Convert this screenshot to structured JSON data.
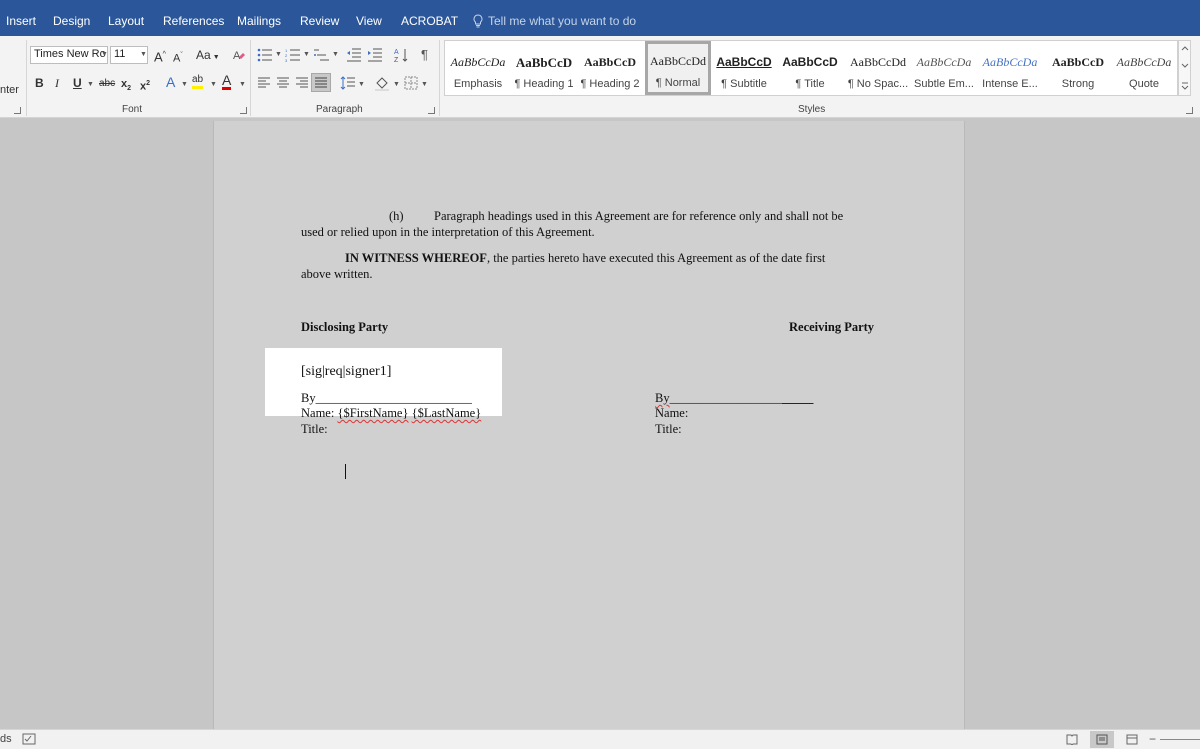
{
  "tabs": [
    "Insert",
    "Design",
    "Layout",
    "References",
    "Mailings",
    "Review",
    "View",
    "ACROBAT"
  ],
  "tell_me": "Tell me what you want to do",
  "ribbon": {
    "clipboard_fragment": "nter",
    "font": {
      "name": "Times New Ro",
      "size": "11",
      "grow": "A",
      "shrink": "A",
      "change_case": "Aa",
      "bold": "B",
      "italic": "I",
      "underline": "U",
      "strikethrough": "abc",
      "subscript": "x",
      "superscript": "x",
      "text_effects": "A",
      "highlight": "ab",
      "font_color": "A",
      "group_label": "Font"
    },
    "paragraph": {
      "group_label": "Paragraph",
      "pilcrow": "¶"
    },
    "styles": {
      "group_label": "Styles",
      "items": [
        {
          "preview": "AaBbCcDa",
          "name": "Emphasis"
        },
        {
          "preview": "AaBbCcD",
          "name": "¶ Heading 1"
        },
        {
          "preview": "AaBbCcD",
          "name": "¶ Heading 2"
        },
        {
          "preview": "AaBbCcDd",
          "name": "¶ Normal"
        },
        {
          "preview": "AaBbCcD",
          "name": "¶ Subtitle"
        },
        {
          "preview": "AaBbCcD",
          "name": "¶ Title"
        },
        {
          "preview": "AaBbCcDd",
          "name": "¶ No Spac..."
        },
        {
          "preview": "AaBbCcDa",
          "name": "Subtle Em..."
        },
        {
          "preview": "AaBbCcDa",
          "name": "Intense E..."
        },
        {
          "preview": "AaBbCcD",
          "name": "Strong"
        },
        {
          "preview": "AaBbCcDa",
          "name": "Quote"
        }
      ],
      "selected_index": 3
    }
  },
  "document": {
    "para_h_label": "(h)",
    "para_h_line1": "Paragraph headings used in this Agreement are for reference only and shall not be",
    "para_h_line2": "used or relied upon in the interpretation of this Agreement.",
    "witness_bold": "IN WITNESS WHEREOF",
    "witness_line1_rest": ", the parties hereto have executed this Agreement as of the date first",
    "witness_line2": "above written.",
    "disclosing_party": "Disclosing Party",
    "receiving_party": "Receiving Party",
    "sig_tag": "[sig|req|signer1]",
    "left_by": "By_________________________",
    "left_name_prefix": "Name: ",
    "left_name_first": "{$FirstName}",
    "left_name_last": "{$LastName}",
    "left_title": "Title:",
    "right_by": "By",
    "right_by_line": "__________________",
    "right_by_line2": "_____",
    "right_name": "Name:",
    "right_title": "Title:"
  },
  "status": {
    "left_fragment": "ds"
  },
  "colors": {
    "tab_bar": "#2b579a",
    "ribbon": "#f3f3f3",
    "doc_background": "#d0d0d0",
    "highlight_box": "#ffffff"
  }
}
